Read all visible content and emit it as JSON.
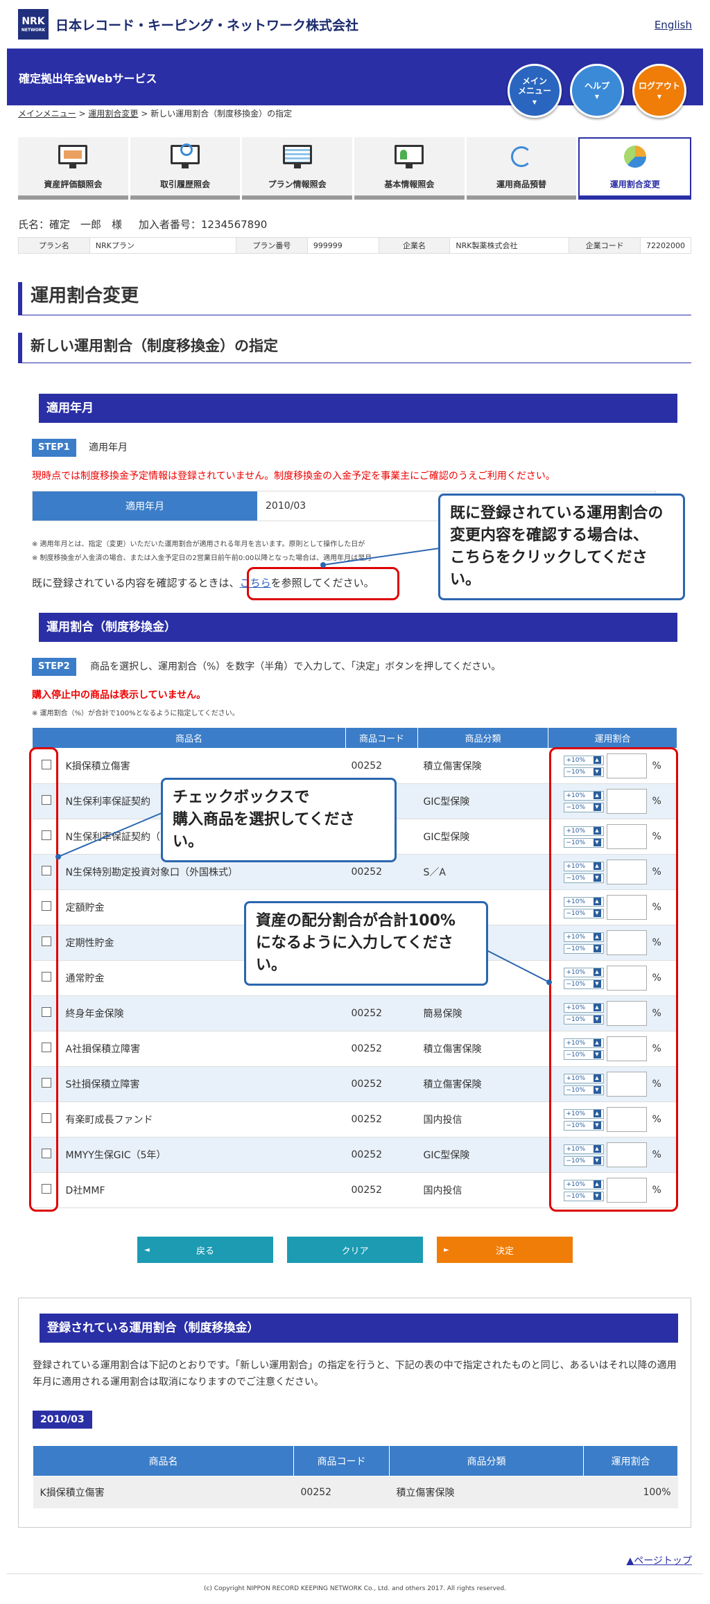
{
  "header": {
    "logo_text": "NRK",
    "logo_sub": "NETWORK",
    "company": "日本レコード・キーピング・ネットワーク株式会社",
    "english_link": "English"
  },
  "service_bar": {
    "title": "確定拠出年金Webサービス",
    "menu_button": "メイン\nメニュー",
    "help_button": "ヘルプ",
    "logout_button": "ログアウト"
  },
  "breadcrumb": {
    "items": [
      "メインメニュー",
      "運用割合変更"
    ],
    "current": "新しい運用割合（制度移換金）の指定",
    "sep": ">"
  },
  "tabs": [
    {
      "label": "資産評価額照会",
      "icon": "asset-icon"
    },
    {
      "label": "取引履歴照会",
      "icon": "history-search-icon"
    },
    {
      "label": "プラン情報照会",
      "icon": "plan-info-icon"
    },
    {
      "label": "基本情報照会",
      "icon": "basic-info-icon"
    },
    {
      "label": "運用商品預替",
      "icon": "switching-icon"
    },
    {
      "label": "運用割合変更",
      "icon": "pie-chart-icon",
      "active": true
    }
  ],
  "user": {
    "name_line": "氏名：確定　一郎　様",
    "member_line": "加入者番号：1234567890"
  },
  "plan_info": {
    "plan_name_label": "プラン名",
    "plan_name": "NRKプラン",
    "plan_no_label": "プラン番号",
    "plan_no": "999999",
    "company_label": "企業名",
    "company": "NRK製薬株式会社",
    "company_code_label": "企業コード",
    "company_code": "72202000"
  },
  "page_title": "運用割合変更",
  "sub_title": "新しい運用割合（制度移換金）の指定",
  "section1": {
    "title": "適用年月",
    "step": "STEP1",
    "step_text": "適用年月",
    "warning": "現時点では制度移換金予定情報は登録されていません。制度移換金の入金予定を事業主にご確認のうえご利用ください。",
    "year_label": "適用年月",
    "year_value": "2010/03",
    "note1": "※ 適用年月とは、指定（変更）いただいた運用割合が適用される年月を言います。原則として操作した日が",
    "note2": "※ 制度移換金が入金済の場合、または入金予定日の2営業日前午前0:00以降となった場合は、適用年月は翌月",
    "link_prefix": "既に登録されている内容を確認するときは、",
    "link_text": "こちら",
    "link_suffix": "を参照してください。"
  },
  "section2": {
    "title": "運用割合（制度移換金）",
    "step": "STEP2",
    "step_text": "商品を選択し、運用割合（%）を数字（半角）で入力して、「決定」ボタンを押してください。",
    "warning": "購入停止中の商品は表示していません。",
    "note": "※ 運用割合（%）が合計で100%となるように指定してください。",
    "columns": [
      "商品名",
      "商品コード",
      "商品分類",
      "運用割合"
    ],
    "plus": "+10%",
    "minus": "−10%",
    "pct": "%",
    "products": [
      {
        "name": "K損保積立傷害",
        "code": "00252",
        "category": "積立傷害保険"
      },
      {
        "name": "N生保利率保証契約",
        "code": "",
        "category": "GIC型保険"
      },
      {
        "name": "N生保利率保証契約（10年）",
        "code": "",
        "category": "GIC型保険"
      },
      {
        "name": "N生保特別勘定投資対象口（外国株式）",
        "code": "00252",
        "category": "S／A"
      },
      {
        "name": "定額貯金",
        "code": "",
        "category": ""
      },
      {
        "name": "定期性貯金",
        "code": "",
        "category": ""
      },
      {
        "name": "通常貯金",
        "code": "00252",
        "category": "通常貯金"
      },
      {
        "name": "終身年金保険",
        "code": "00252",
        "category": "簡易保険"
      },
      {
        "name": "A社損保積立障害",
        "code": "00252",
        "category": "積立傷害保険"
      },
      {
        "name": "S社損保積立障害",
        "code": "00252",
        "category": "積立傷害保険"
      },
      {
        "name": "有楽町成長ファンド",
        "code": "00252",
        "category": "国内投信"
      },
      {
        "name": "MMYY生保GIC（5年）",
        "code": "00252",
        "category": "GIC型保険"
      },
      {
        "name": "D社MMF",
        "code": "00252",
        "category": "国内投信"
      }
    ]
  },
  "callouts": {
    "confirm": "既に登録されている運用割合の\n変更内容を確認する場合は、\nこちらをクリックしてください。",
    "checkbox": "チェックボックスで\n購入商品を選択してください。",
    "ratio": "資産の配分割合が合計100%\nになるように入力してください。"
  },
  "buttons": {
    "back": "戻る",
    "clear": "クリア",
    "ok": "決定"
  },
  "registered": {
    "title": "登録されている運用割合（制度移換金）",
    "text": "登録されている運用割合は下記のとおりです。「新しい運用割合」の指定を行うと、下記の表の中で指定されたものと同じ、あるいはそれ以降の適用年月に適用される運用割合は取消になりますのでご注意ください。",
    "date": "2010/03",
    "columns": [
      "商品名",
      "商品コード",
      "商品分類",
      "運用割合"
    ],
    "rows": [
      {
        "name": "K損保積立傷害",
        "code": "00252",
        "category": "積立傷害保険",
        "ratio": "100%"
      }
    ]
  },
  "footer": {
    "page_top": "ページトップ",
    "copyright": "(c) Copyright NIPPON RECORD KEEPING NETWORK Co., Ltd. and others 2017. All rights reserved."
  },
  "colors": {
    "brand": "#2a2fa6",
    "table_head": "#3b7dc8",
    "warning": "#e00000",
    "accent_orange": "#ef7d08",
    "teal": "#1c9bb3",
    "callout_border": "#2a66b0"
  }
}
